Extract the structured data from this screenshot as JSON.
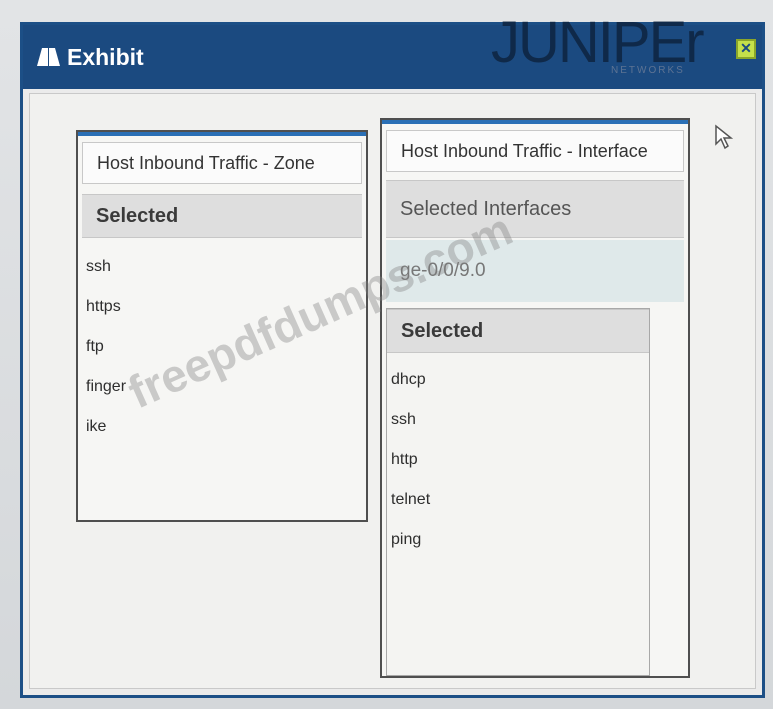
{
  "window": {
    "title": "Exhibit",
    "brand": "JUNIPEr",
    "brand_sub": "NETWORKS",
    "title_bar_color": "#1b4a80"
  },
  "zone_panel": {
    "header": "Host Inbound Traffic - Zone",
    "section": "Selected",
    "items": [
      "ssh",
      "https",
      "ftp",
      "finger",
      "ike"
    ]
  },
  "interface_panel": {
    "header": "Host Inbound Traffic - Interface",
    "section": "Selected Interfaces",
    "interface": "ge-0/0/9.0",
    "sub_section": "Selected",
    "items": [
      "dhcp",
      "ssh",
      "http",
      "telnet",
      "ping"
    ]
  },
  "watermark": "freepdfdumps.com",
  "icons": {
    "title": "exhibit-book-icon",
    "close": "close-icon",
    "cursor": "mouse-pointer-icon"
  },
  "colors": {
    "accent_line": "#2a6fb5",
    "close_button": "#c5e04a"
  }
}
